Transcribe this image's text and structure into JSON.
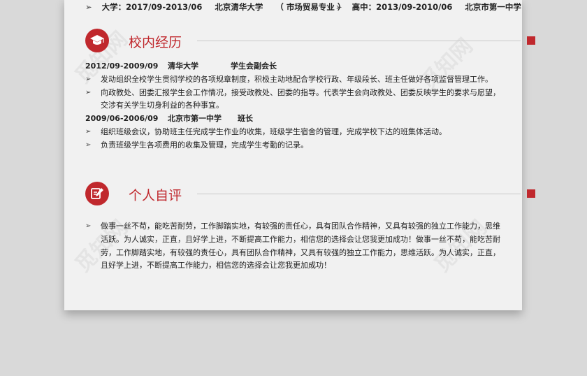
{
  "education": {
    "left": {
      "text": "大学：2017/09-2013/06",
      "school": "北京清华大学",
      "major": "（ 市场贸易专业 ）"
    },
    "right": {
      "text": "高中：2013/09-2010/06",
      "school": "北京市第一中学"
    }
  },
  "campus": {
    "title": "校内经历",
    "entries": [
      {
        "date": "2012/09-2009/09",
        "org": "清华大学",
        "role": "学生会副会长",
        "lines": [
          {
            "type": "bullet",
            "text": "发动组织全校学生贯彻学校的各项规章制度，积极主动地配合学校行政、年级段长、班主任做好各项监督管理工作。"
          },
          {
            "type": "bullet",
            "text": "向政教处、团委汇报学生会工作情况，接受政教处、团委的指导。代表学生会向政教处、团委反映学生的要求与愿望，"
          },
          {
            "type": "cont",
            "text": "交涉有关学生切身利益的各种事宜。"
          }
        ]
      },
      {
        "date": "2009/06-2006/09",
        "org": "北京市第一中学",
        "role": "班长",
        "lines": [
          {
            "type": "bullet",
            "text": "组织班级会议，协助班主任完成学生作业的收集，班级学生宿舍的管理，完成学校下达的班集体活动。"
          },
          {
            "type": "bullet",
            "text": "负责班级学生各项费用的收集及管理，完成学生考勤的记录。"
          }
        ]
      }
    ]
  },
  "self": {
    "title": "个人自评",
    "lines": [
      {
        "type": "bullet",
        "text": "做事一丝不苟，能吃苦耐劳，工作脚踏实地，有较强的责任心，具有团队合作精神，又具有较强的独立工作能力，思维"
      },
      {
        "type": "cont",
        "text": "活跃。为人诚实，正直，且好学上进，不断提高工作能力，相信您的选择会让您我更加成功！做事一丝不苟，能吃苦耐"
      },
      {
        "type": "cont",
        "text": "劳，工作脚踏实地，有较强的责任心，具有团队合作精神，又具有较强的独立工作能力，思维活跃。为人诚实，正直，"
      },
      {
        "type": "cont",
        "text": "且好学上进，不断提高工作能力，相信您的选择会让您我更加成功！"
      }
    ]
  },
  "colors": {
    "accent": "#c0282d",
    "paper": "#f1f1f1",
    "background": "#d9d9d9"
  },
  "icons": {
    "campus": "graduation-cap-icon",
    "self": "edit-icon",
    "bullet": "arrow-bullet-icon"
  },
  "watermark": "觅知网"
}
